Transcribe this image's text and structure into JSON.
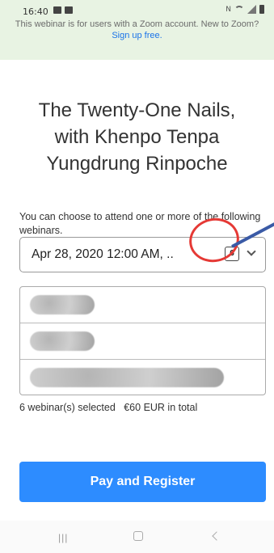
{
  "status": {
    "time": "16:40",
    "left_icons": [
      "gallery-icon",
      "message-icon"
    ],
    "right_icons": [
      "vibrate-icon",
      "wifi-icon",
      "signal-icon",
      "battery-icon"
    ]
  },
  "notice": {
    "text": "This webinar is for users with a Zoom account. New to Zoom?",
    "link": "Sign up free."
  },
  "title": {
    "line1": "The Twenty-One Nails,",
    "line2": "with Khenpo Tenpa",
    "line3": "Yungdrung Rinpoche"
  },
  "intro": "You can choose to attend one or more of the following webinars.",
  "date_select": {
    "value": "Apr 28, 2020 12:00 AM, ..",
    "count": "6"
  },
  "summary": {
    "selected": "6 webinar(s) selected",
    "total": "€60 EUR in total"
  },
  "pay_button": "Pay and Register",
  "nav": {
    "recent": "|||"
  },
  "colors": {
    "accent": "#2d8cff",
    "banner": "#e8f3e3",
    "annotation_circle": "#e53935",
    "annotation_arrow": "#3a5aa6"
  }
}
